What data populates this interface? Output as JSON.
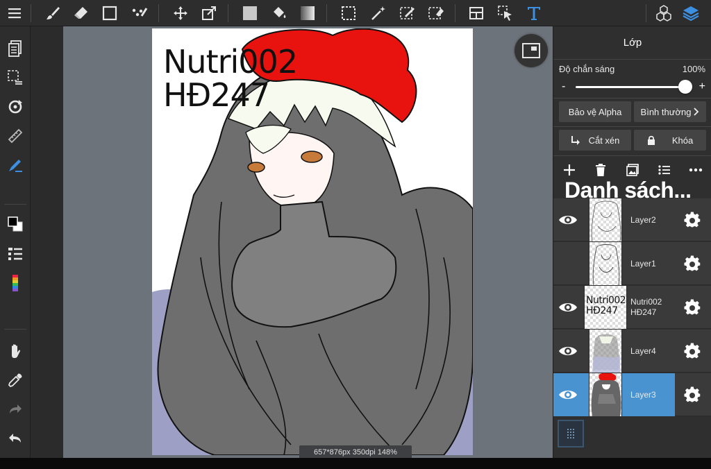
{
  "canvas": {
    "art_text_line1": "Nutri002",
    "art_text_line2": "HĐ247",
    "status": "657*876px 350dpi 148%"
  },
  "layer_panel": {
    "title": "Lớp",
    "opacity_label": "Độ chắn sáng",
    "opacity_value": "100%",
    "opacity_fraction": 1.0,
    "opacity_minus": "-",
    "opacity_plus": "+",
    "protect_alpha": "Bảo vệ Alpha",
    "blend_mode": "Bình thường",
    "clipping": "Cắt xén",
    "lock": "Khóa",
    "list_title": "Danh sách...",
    "layers": [
      {
        "name": "Layer2",
        "visible": true,
        "selected": false
      },
      {
        "name": "Layer1",
        "visible": false,
        "selected": false
      },
      {
        "name_line1": "Nutri002",
        "name_line2": "HĐ247",
        "thumb_line1": "Nutri002",
        "thumb_line2": "HĐ247",
        "visible": true,
        "selected": false
      },
      {
        "name": "Layer4",
        "visible": true,
        "selected": false
      },
      {
        "name": "Layer3",
        "visible": true,
        "selected": true
      }
    ]
  },
  "colors": {
    "accent": "#4a93d1",
    "toolbar_icon": "#e6e6e6",
    "text_tool_icon": "#3d8fe0",
    "layers_icon_active": "#3d8fe0",
    "bow_red": "#e8120f",
    "canvas_backdrop": "#6d737a"
  }
}
